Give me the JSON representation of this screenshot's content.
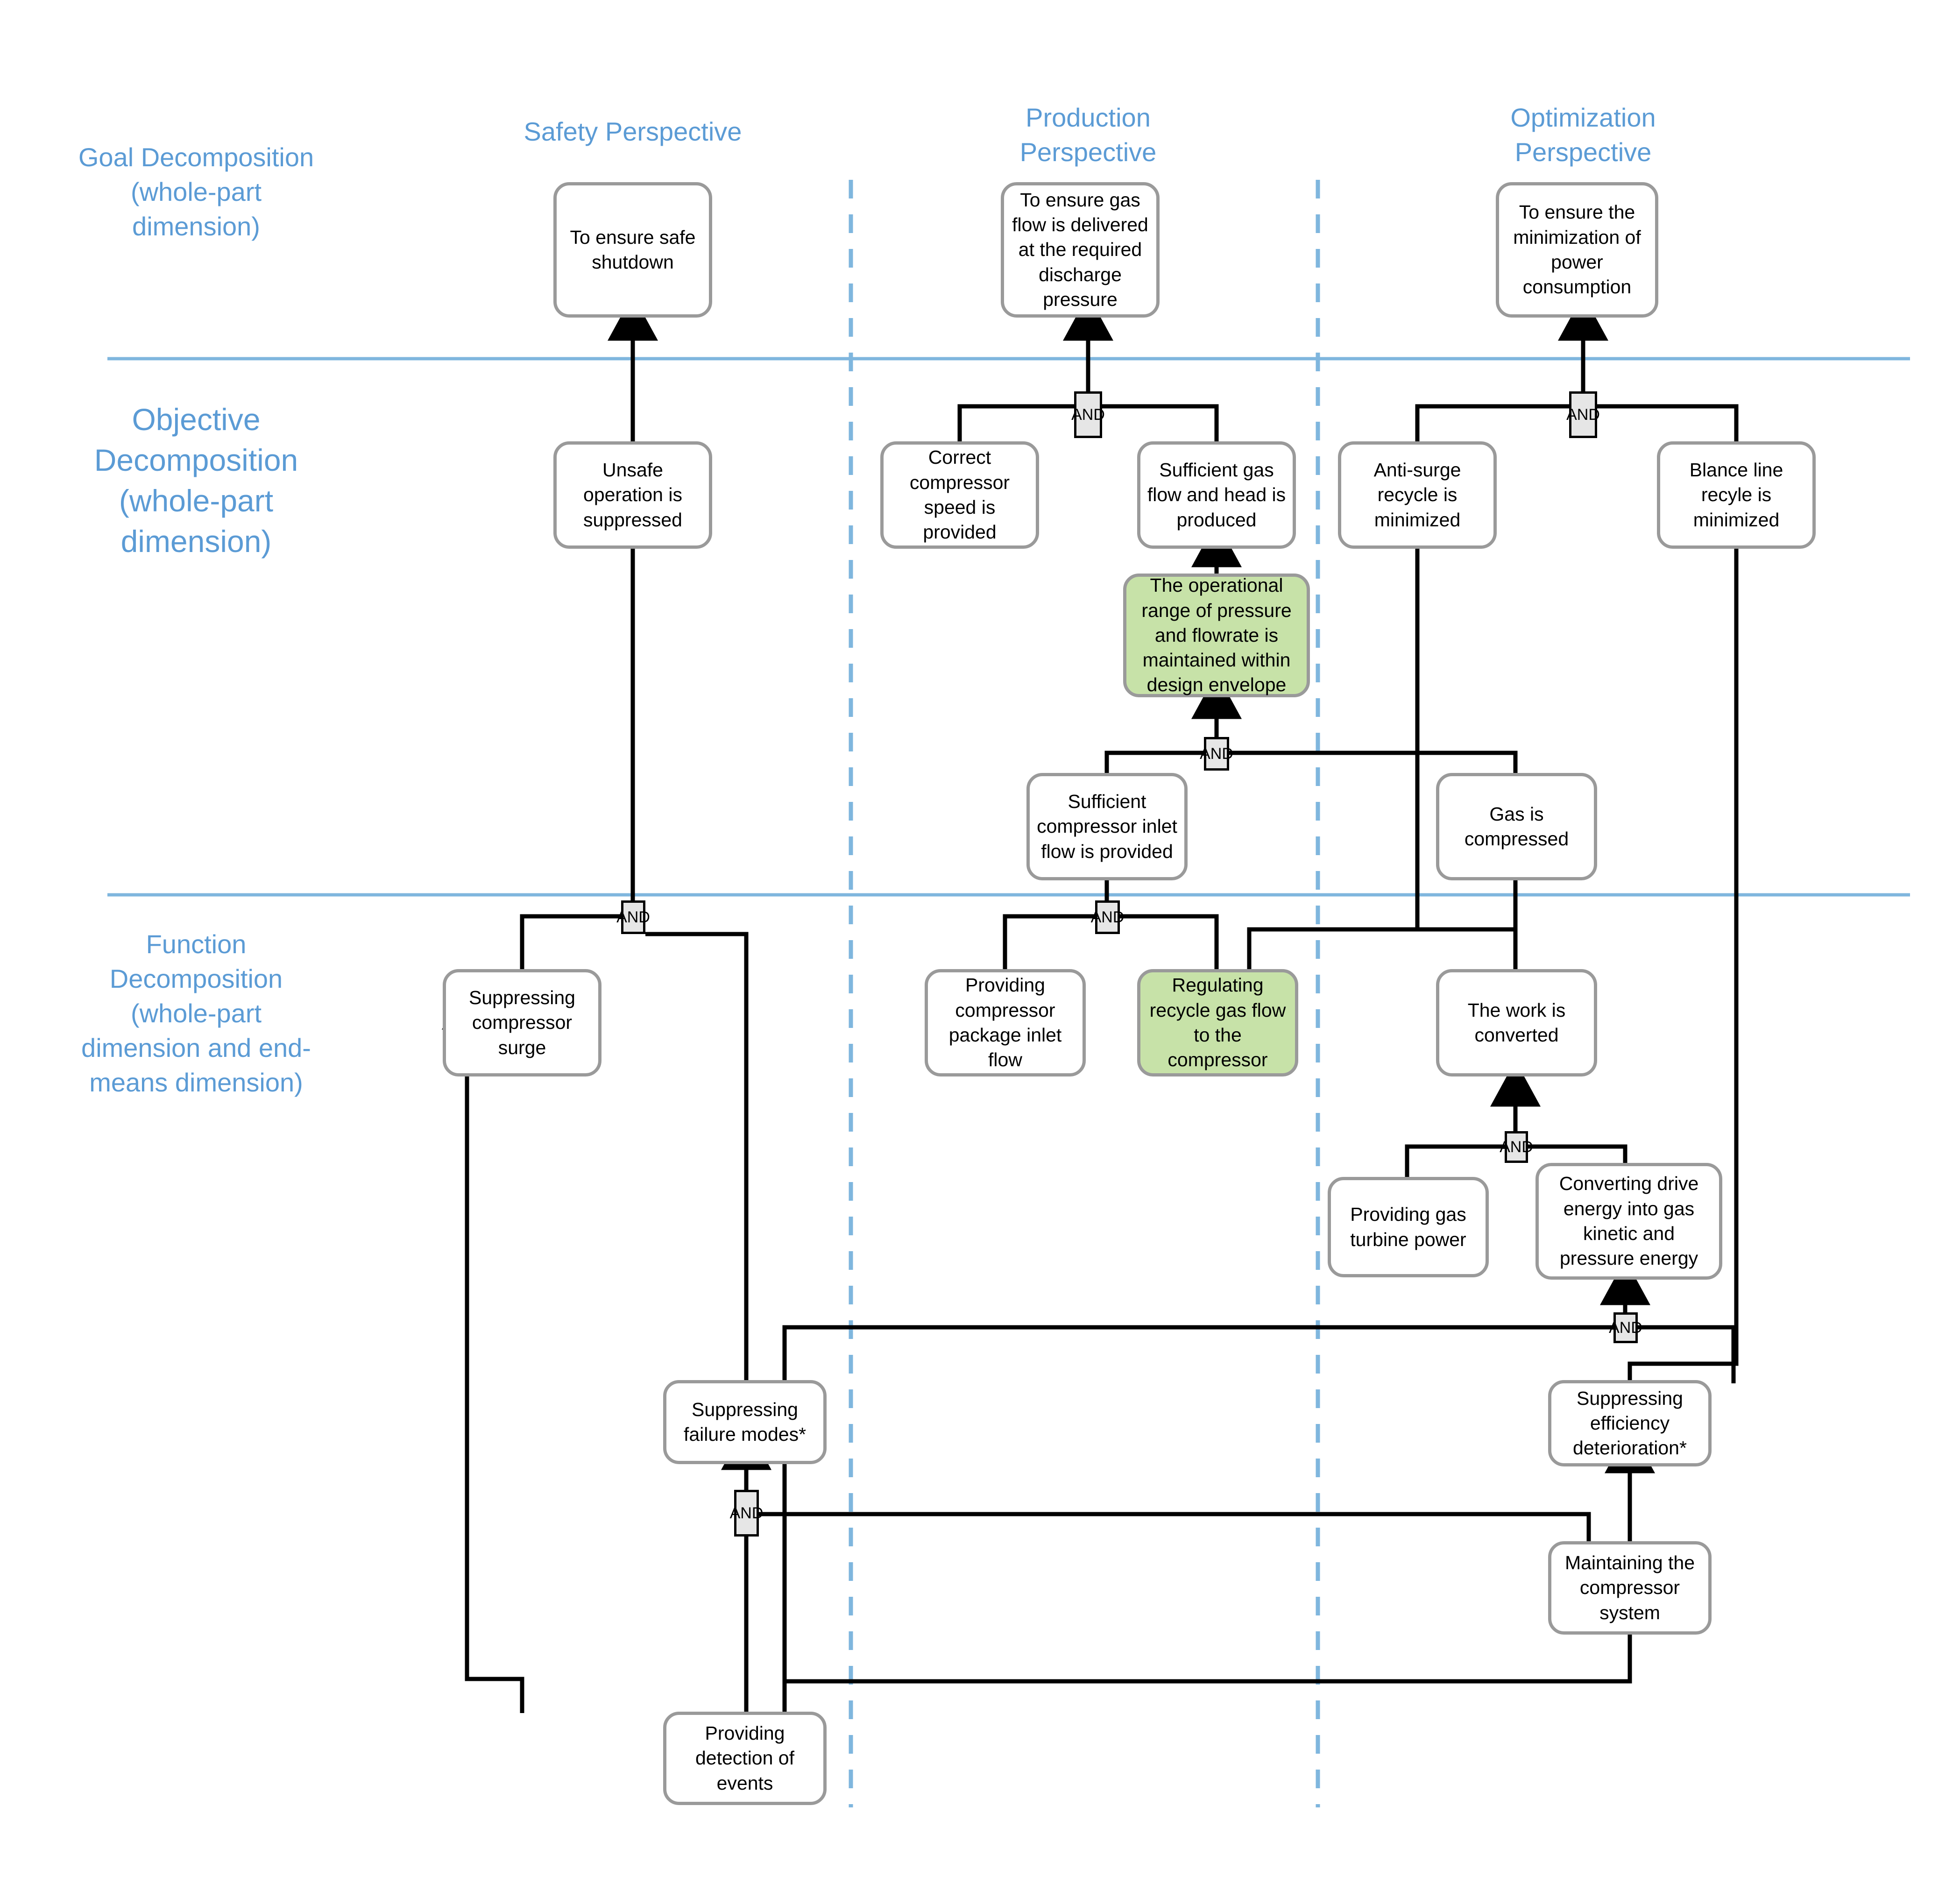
{
  "row_labels": [
    {
      "id": "goal",
      "text": "Goal Decomposition (whole-part dimension)"
    },
    {
      "id": "objective",
      "text": "Objective Decomposition (whole-part dimension)"
    },
    {
      "id": "function",
      "text": "Function Decomposition (whole-part dimension and end-means dimension)"
    }
  ],
  "column_headers": [
    {
      "id": "safety",
      "text": "Safety Perspective"
    },
    {
      "id": "production",
      "text": "Production Perspective"
    },
    {
      "id": "optimization",
      "text": "Optimization Perspective"
    }
  ],
  "gate_label": "AND",
  "colors": {
    "accent_blue": "#5B9BD5",
    "divider_blue": "#7FB6DE",
    "node_border": "#9a9a9a",
    "highlight_green": "#c7e2a8",
    "gate_fill": "#e6e6e6",
    "wire": "#000000"
  },
  "nodes": [
    {
      "id": "n_safe_shutdown",
      "text": "To ensure safe shutdown"
    },
    {
      "id": "n_gas_flow_goal",
      "text": "To ensure gas flow is delivered at the required discharge pressure"
    },
    {
      "id": "n_power_goal",
      "text": "To ensure the minimization of power consumption"
    },
    {
      "id": "n_unsafe_suppressed",
      "text": "Unsafe operation is suppressed"
    },
    {
      "id": "n_correct_speed",
      "text": "Correct compressor speed is provided"
    },
    {
      "id": "n_suff_flow_head",
      "text": "Sufficient gas flow and head is produced"
    },
    {
      "id": "n_antisurge",
      "text": "Anti-surge recycle is minimized"
    },
    {
      "id": "n_blance_line",
      "text": "Blance line recyle is minimized"
    },
    {
      "id": "n_operational_range",
      "text": "The operational range of pressure and flowrate is maintained within design envelope"
    },
    {
      "id": "n_suff_inlet_flow",
      "text": "Sufficient compressor inlet flow is provided"
    },
    {
      "id": "n_gas_compressed",
      "text": "Gas is compressed"
    },
    {
      "id": "n_suppress_surge",
      "text": "Suppressing compressor surge"
    },
    {
      "id": "n_provide_pkg_inlet",
      "text": "Providing compressor package inlet flow"
    },
    {
      "id": "n_regulate_recycle",
      "text": "Regulating recycle gas flow to the compressor"
    },
    {
      "id": "n_work_converted",
      "text": "The work is converted"
    },
    {
      "id": "n_gas_turbine_power",
      "text": "Providing gas turbine  power"
    },
    {
      "id": "n_converting_drive",
      "text": "Converting drive energy into gas kinetic and pressure energy"
    },
    {
      "id": "n_suppress_failure",
      "text": "Suppressing failure modes*"
    },
    {
      "id": "n_suppress_efficiency",
      "text": "Suppressing efficiency deterioration*"
    },
    {
      "id": "n_maintaining_system",
      "text": "Maintaining the compressor system"
    },
    {
      "id": "n_providing_detection",
      "text": "Providing detection of events"
    }
  ],
  "gates": [
    {
      "id": "g_prod_goal"
    },
    {
      "id": "g_opt_goal"
    },
    {
      "id": "g_range"
    },
    {
      "id": "g_safety_fn"
    },
    {
      "id": "g_prod_fn"
    },
    {
      "id": "g_work"
    },
    {
      "id": "g_converting"
    },
    {
      "id": "g_detection"
    }
  ]
}
